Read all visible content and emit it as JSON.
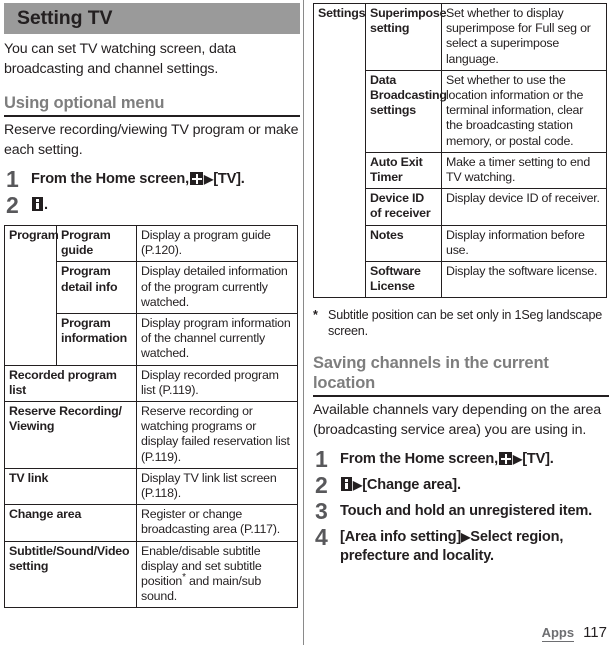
{
  "document": {
    "chapter_title": "Setting TV",
    "footer": {
      "chapter": "Apps",
      "page": "117"
    }
  },
  "left": {
    "intro": "You can set TV watching screen, data broadcasting and channel settings.",
    "section1": {
      "heading": "Using optional menu",
      "intro": "Reserve recording/viewing TV program or make each setting.",
      "steps": [
        {
          "num": "1",
          "text_before": "From the Home screen,",
          "icon1": "apps-grid-icon",
          "arrow": "▶",
          "text_after": "[TV]."
        },
        {
          "num": "2",
          "icon1": "overflow-menu-icon",
          "text_after": "."
        }
      ]
    },
    "table": {
      "rows": [
        {
          "c1": "Program",
          "c1_rowspan": 3,
          "c2": "Program guide",
          "c3": "Display a program guide (P.120)."
        },
        {
          "c2": "Program detail info",
          "c3": "Display detailed information of the program currently watched."
        },
        {
          "c2": "Program information",
          "c3": "Display program information of the channel currently watched."
        },
        {
          "c1": "Recorded program list",
          "c1_colspan": 2,
          "c3": "Display recorded program list (P.119)."
        },
        {
          "c1": "Reserve Recording/ Viewing",
          "c1_colspan": 2,
          "c3": "Reserve recording or watching programs or display failed reservation list (P.119)."
        },
        {
          "c1": "TV link",
          "c1_colspan": 2,
          "c3": "Display TV link list screen (P.118)."
        },
        {
          "c1": "Change area",
          "c1_colspan": 2,
          "c3": "Register or change broadcasting area (P.117)."
        },
        {
          "c1": "Subtitle/Sound/Video setting",
          "c1_colspan": 2,
          "c3_pre": "Enable/disable subtitle display and set subtitle position",
          "c3_sup": "*",
          "c3_post": " and main/sub sound."
        }
      ]
    }
  },
  "right": {
    "table": {
      "rows": [
        {
          "c1": "Settings",
          "c1_rowspan": 5,
          "c2": "Superimpose setting",
          "c3": "Set whether to display superimpose for Full seg or select a superimpose language."
        },
        {
          "c2": "Data Broadcasting settings",
          "c3": "Set whether to use the location information or the terminal information, clear the broadcasting station memory, or postal code."
        },
        {
          "c2": "Auto Exit Timer",
          "c3": "Make a timer setting to end TV watching."
        },
        {
          "c2": "Device ID of receiver",
          "c3": "Display device ID of receiver."
        },
        {
          "c2": "Notes",
          "c3": "Display information before use."
        },
        {
          "c2": "Software License",
          "c3": "Display the software license."
        }
      ]
    },
    "footnote": {
      "mark": "*",
      "text": "Subtitle position can be set only in 1Seg landscape screen."
    },
    "section2": {
      "heading": "Saving channels in the current location",
      "intro": "Available channels vary depending on the area (broadcasting service area) you are using in.",
      "steps": [
        {
          "num": "1",
          "text_before": "From the Home screen,",
          "icon1": "apps-grid-icon",
          "arrow": "▶",
          "text_after": "[TV]."
        },
        {
          "num": "2",
          "icon1": "overflow-menu-icon",
          "arrow": "▶",
          "text_after": "[Change area]."
        },
        {
          "num": "3",
          "text_before": "Touch and hold an unregistered item."
        },
        {
          "num": "4",
          "text_before": "[Area info setting]",
          "arrow": "▶",
          "text_after": "Select region, prefecture and locality."
        }
      ]
    }
  }
}
